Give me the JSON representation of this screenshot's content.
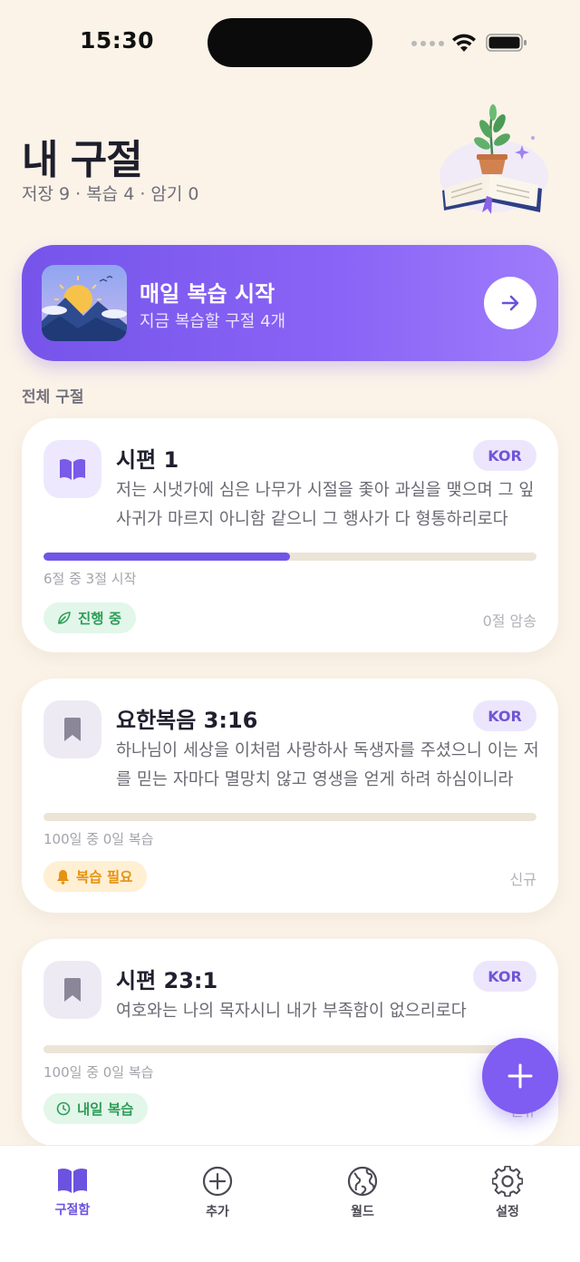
{
  "status_bar": {
    "time": "15:30"
  },
  "header": {
    "title": "내 구절",
    "stats": "저장 9 · 복습 4 · 암기 0"
  },
  "banner": {
    "title": "매일 복습 시작",
    "subtitle": "지금 복습할 구절 4개"
  },
  "section_label": "전체 구절",
  "verses": [
    {
      "title": "시편 1",
      "lang": "KOR",
      "text": "저는 시냇가에 심은 나무가 시절을 좇아 과실을 맺으며 그 잎사귀가 마르지 아니함 같으니 그 행사가 다 형통하리로다",
      "progress": 0.5,
      "progress_label": "6절 중 3절 시작",
      "status": "진행 중",
      "right_meta": "0절 암송"
    },
    {
      "title": "요한복음 3:16",
      "lang": "KOR",
      "text": "하나님이 세상을 이처럼 사랑하사 독생자를 주셨으니 이는 저를 믿는 자마다 멸망치 않고 영생을 얻게 하려 하심이니라",
      "progress": 0,
      "progress_label": "100일 중 0일 복습",
      "status": "복습 필요",
      "right_meta": "신규"
    },
    {
      "title": "시편 23:1",
      "lang": "KOR",
      "text": "여호와는 나의 목자시니 내가 부족함이 없으리로다",
      "progress": 0,
      "progress_label": "100일 중 0일 복습",
      "status": "내일 복습",
      "right_meta": "신규"
    }
  ],
  "tabs": [
    {
      "label": "구절함",
      "icon": "book-open-icon",
      "active": true
    },
    {
      "label": "추가",
      "icon": "plus-circle-icon",
      "active": false
    },
    {
      "label": "월드",
      "icon": "globe-icon",
      "active": false
    },
    {
      "label": "설정",
      "icon": "gear-icon",
      "active": false
    }
  ],
  "colors": {
    "background": "#fbf3e8",
    "accent": "#7654ea",
    "green": "#2e9e58",
    "orange": "#e69212"
  }
}
